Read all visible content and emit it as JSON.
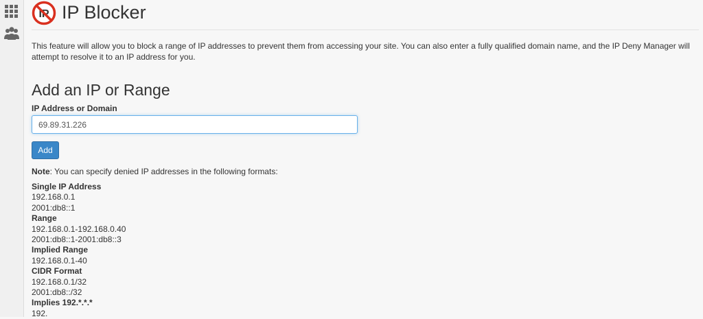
{
  "sidebar": {
    "icons": [
      "grid-icon",
      "users-icon"
    ]
  },
  "page": {
    "title": "IP Blocker",
    "description": "This feature will allow you to block a range of IP addresses to prevent them from accessing your site. You can also enter a fully qualified domain name, and the IP Deny Manager will attempt to resolve it to an IP address for you."
  },
  "add_section": {
    "heading": "Add an IP or Range",
    "field_label": "IP Address or Domain",
    "field_value": "69.89.31.226",
    "add_button": "Add"
  },
  "note": {
    "label": "Note",
    "text": ": You can specify denied IP addresses in the following formats:"
  },
  "formats": [
    {
      "heading": "Single IP Address",
      "examples": [
        "192.168.0.1",
        "2001:db8::1"
      ]
    },
    {
      "heading": "Range",
      "examples": [
        "192.168.0.1-192.168.0.40",
        "2001:db8::1-2001:db8::3"
      ]
    },
    {
      "heading": "Implied Range",
      "examples": [
        "192.168.0.1-40"
      ]
    },
    {
      "heading": "CIDR Format",
      "examples": [
        "192.168.0.1/32",
        "2001:db8::/32"
      ]
    },
    {
      "heading": "Implies 192.*.*.*",
      "examples": [
        "192."
      ]
    }
  ],
  "colors": {
    "accent": "#3a87c8",
    "logo_red": "#d9301f"
  }
}
